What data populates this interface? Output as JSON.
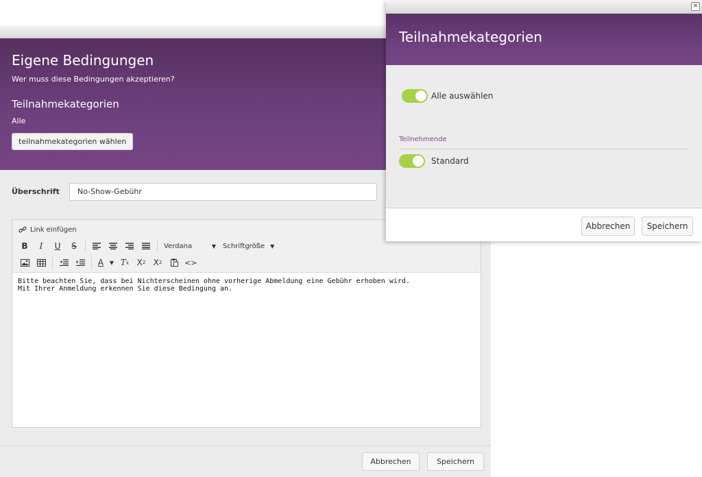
{
  "back_dialog": {
    "title": "Eigene Bedingungen",
    "subtitle": "Wer muss diese Bedingungen akzeptieren?",
    "section_title": "Teilnahmekategorien",
    "section_value": "Alle",
    "choose_button": "teilnahmekategorien wählen",
    "heading_label": "Überschrift",
    "heading_value": "No-Show-Gebühr",
    "editor": {
      "link_label": "Link einfügen",
      "font_family": "Verdana",
      "font_size": "Schriftgröße",
      "content_lines": [
        "Bitte beachten Sie, dass bei Nichterscheinen ohne vorherige Abmeldung eine Gebühr erhoben wird.",
        "Mit Ihrer Anmeldung erkennen Sie diese Bedingung an."
      ]
    },
    "cancel_button": "Abbrechen",
    "save_button": "Speichern"
  },
  "front_dialog": {
    "title": "Teilnahmekategorien",
    "select_all_label": "Alle auswählen",
    "select_all_on": true,
    "group_label": "Teilnehmende",
    "items": [
      {
        "label": "Standard",
        "on": true
      }
    ],
    "cancel_button": "Abbrechen",
    "save_button": "Speichern"
  },
  "colors": {
    "header_purple": "#6d3f7d",
    "toggle_green": "#a7d14a",
    "group_label_purple": "#7a4a8a"
  }
}
